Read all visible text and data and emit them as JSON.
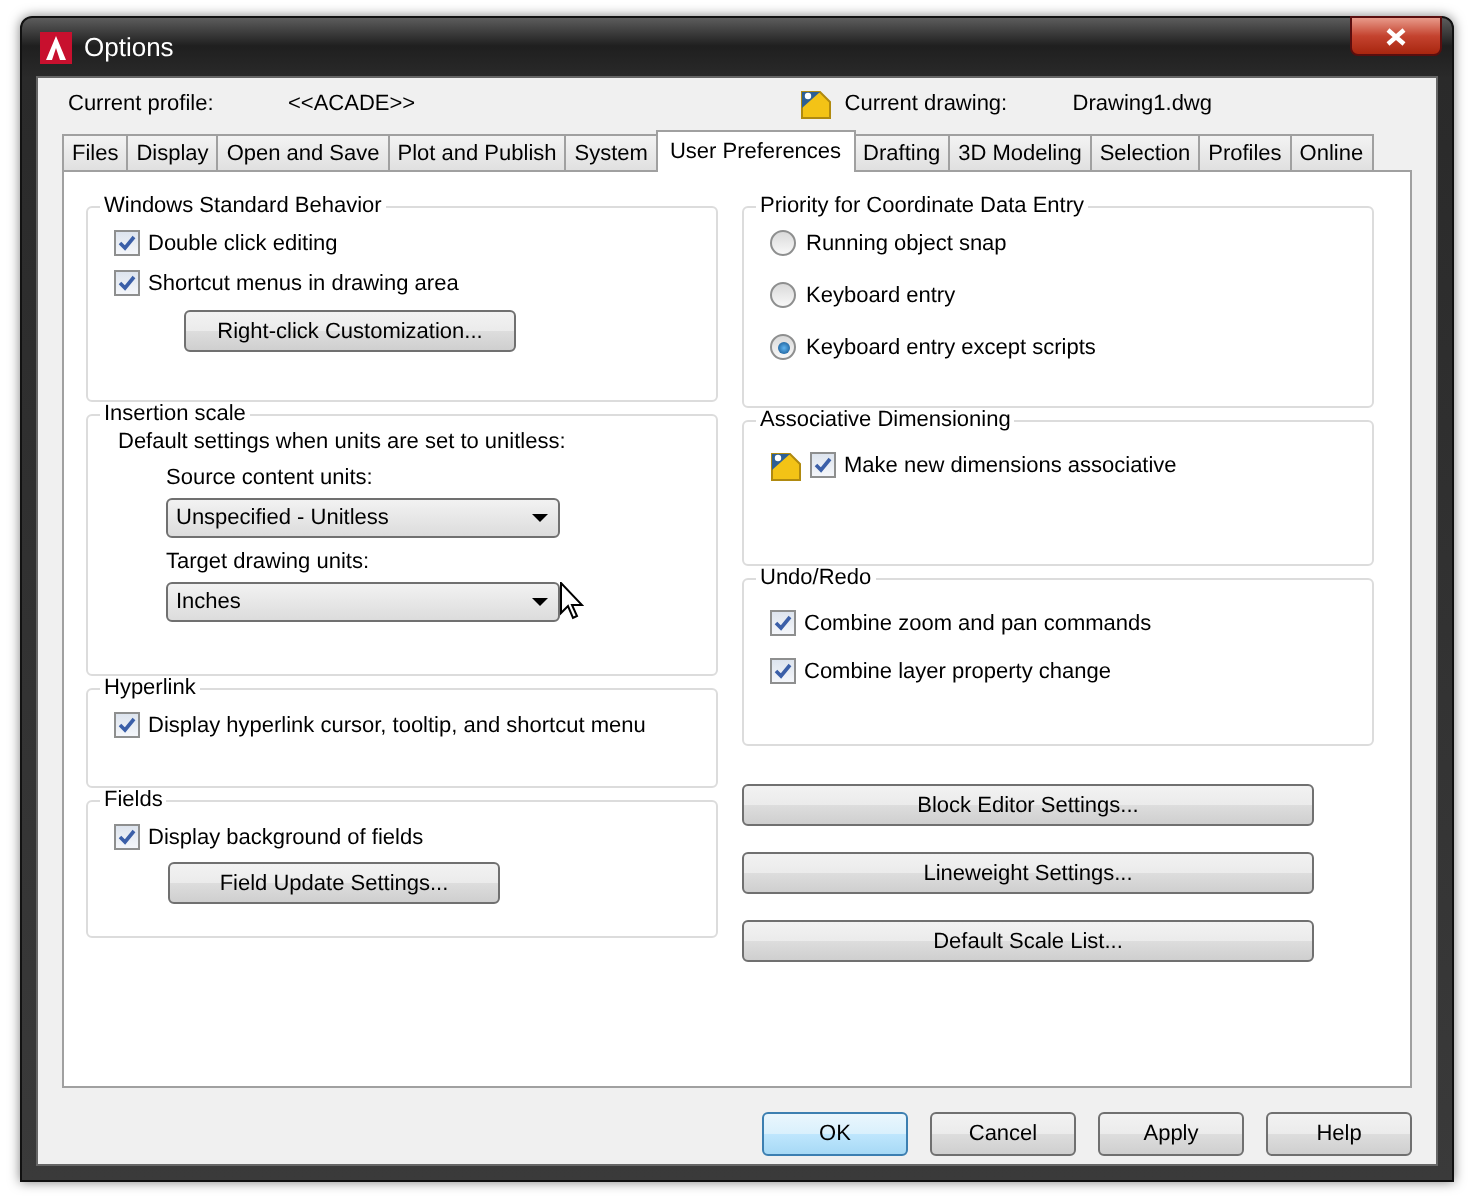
{
  "window": {
    "title": "Options"
  },
  "profile": {
    "label": "Current profile:",
    "value": "<<ACADE>>"
  },
  "drawing": {
    "label": "Current drawing:",
    "value": "Drawing1.dwg"
  },
  "tabs": [
    {
      "label": "Files",
      "selected": false
    },
    {
      "label": "Display",
      "selected": false
    },
    {
      "label": "Open and Save",
      "selected": false
    },
    {
      "label": "Plot and Publish",
      "selected": false
    },
    {
      "label": "System",
      "selected": false
    },
    {
      "label": "User Preferences",
      "selected": true
    },
    {
      "label": "Drafting",
      "selected": false
    },
    {
      "label": "3D Modeling",
      "selected": false
    },
    {
      "label": "Selection",
      "selected": false
    },
    {
      "label": "Profiles",
      "selected": false
    },
    {
      "label": "Online",
      "selected": false
    }
  ],
  "left_groups": [
    {
      "title": "Windows Standard Behavior",
      "items": [
        {
          "kind": "checkbox",
          "label": "Double click editing",
          "checked": true
        },
        {
          "kind": "checkbox",
          "label": "Shortcut menus in drawing area",
          "checked": true
        },
        {
          "kind": "button",
          "label": "Right-click Customization..."
        }
      ]
    },
    {
      "title": "Insertion scale",
      "items": [
        {
          "kind": "note",
          "text": "Default settings when units are set to unitless:"
        },
        {
          "kind": "dropdown",
          "label": "Source content units:",
          "value": "Unspecified - Unitless"
        },
        {
          "kind": "dropdown",
          "label": "Target drawing units:",
          "value": "Inches"
        }
      ]
    },
    {
      "title": "Hyperlink",
      "items": [
        {
          "kind": "checkbox",
          "label": "Display hyperlink cursor, tooltip, and shortcut menu",
          "checked": true
        }
      ]
    },
    {
      "title": "Fields",
      "items": [
        {
          "kind": "checkbox",
          "label": "Display background of fields",
          "checked": true
        },
        {
          "kind": "button",
          "label": "Field Update Settings..."
        }
      ]
    }
  ],
  "right_groups": [
    {
      "title": "Priority for Coordinate Data Entry",
      "items": [
        {
          "kind": "radio",
          "label": "Running object snap",
          "selected": false
        },
        {
          "kind": "radio",
          "label": "Keyboard entry",
          "selected": false
        },
        {
          "kind": "radio",
          "label": "Keyboard entry except scripts",
          "selected": true
        }
      ]
    },
    {
      "title": "Associative Dimensioning",
      "items": [
        {
          "kind": "icon_checkbox",
          "label": "Make new dimensions associative",
          "checked": true
        }
      ]
    },
    {
      "title": "Undo/Redo",
      "items": [
        {
          "kind": "checkbox",
          "label": "Combine zoom and pan commands",
          "checked": true
        },
        {
          "kind": "checkbox",
          "label": "Combine layer property change",
          "checked": true
        }
      ]
    }
  ],
  "right_buttons": [
    "Block Editor Settings...",
    "Lineweight Settings...",
    "Default Scale List..."
  ],
  "buttons": [
    {
      "label": "OK",
      "focused": true
    },
    {
      "label": "Cancel",
      "focused": false
    },
    {
      "label": "Apply",
      "focused": false
    },
    {
      "label": "Help",
      "focused": false
    }
  ]
}
